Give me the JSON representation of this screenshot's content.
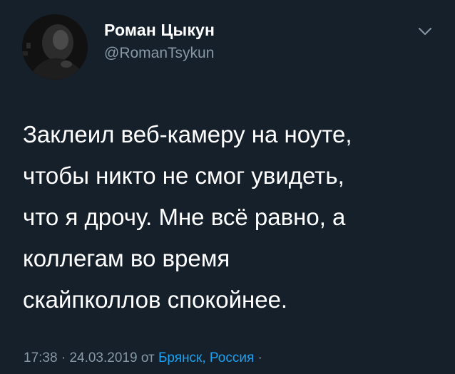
{
  "author": {
    "display_name": "Роман Цыкун",
    "handle": "@RomanTsykun",
    "avatar_icon": "user-avatar-photo"
  },
  "menu": {
    "icon": "chevron-down-icon"
  },
  "tweet": {
    "lines": [
      "Заклеил веб-камеру на ноуте,",
      "чтобы никто не смог увидеть,",
      "что я дрочу. Мне всё равно, а",
      "коллегам во время",
      "скайпколлов спокойнее."
    ]
  },
  "meta": {
    "time": "17:38",
    "separator": "·",
    "date": "24.03.2019",
    "from_label": "от",
    "location": "Брянск, Россия",
    "trailing_separator": "·"
  },
  "colors": {
    "background": "#15202b",
    "primary_text": "#ffffff",
    "secondary_text": "#8899a6",
    "link": "#1da1f2"
  }
}
